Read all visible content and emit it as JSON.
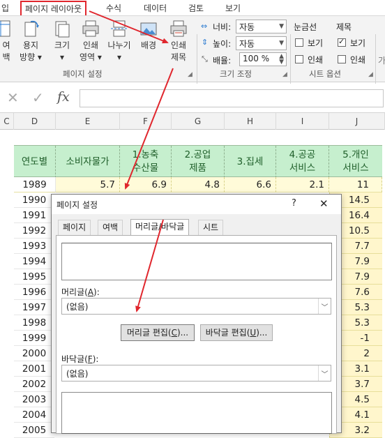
{
  "ribbon": {
    "tabs": [
      "입",
      "페이지 레이아웃",
      "수식",
      "데이터",
      "검토",
      "보기"
    ],
    "buttons": {
      "margins": "여백",
      "orientation": [
        "용지",
        "방향 ▾"
      ],
      "size": [
        "크기",
        "▾"
      ],
      "print_area": [
        "인쇄",
        "영역 ▾"
      ],
      "breaks": [
        "나누기",
        "▾"
      ],
      "background": "배경",
      "print_titles": [
        "인쇄",
        "제목"
      ]
    },
    "group_page_setup": "페이지 설정",
    "group_scale": "크기 조정",
    "group_sheet_options": "시트 옵션",
    "scale": {
      "width_label": "너비:",
      "width_value": "자동",
      "height_label": "높이:",
      "height_value": "자동",
      "scale_label": "배율:",
      "scale_value": "100 %"
    },
    "sheet_options": {
      "gridlines_title": "눈금선",
      "headings_title": "제목",
      "view": "보기",
      "print": "인쇄"
    },
    "edge_label": "가"
  },
  "formula_bar": {
    "cancel": "✕",
    "enter": "✓",
    "fx": "fx",
    "value": ""
  },
  "columns": [
    "C",
    "D",
    "E",
    "F",
    "G",
    "H",
    "I",
    "J"
  ],
  "table": {
    "headers": [
      "연도별",
      "소비자물가",
      "1.농축\n수산물",
      "2.공업\n제품",
      "3.집세",
      "4.공공\n서비스",
      "5.개인\n서비스"
    ],
    "row_1989": [
      "1989",
      "5.7",
      "6.9",
      "4.8",
      "6.6",
      "2.1",
      "11"
    ],
    "years": [
      "1990",
      "1991",
      "1992",
      "1993",
      "1994",
      "1995",
      "1996",
      "1997",
      "1998",
      "1999",
      "2000",
      "2001",
      "2002",
      "2003",
      "2004",
      "2005"
    ],
    "j_values": [
      "14.5",
      "16.4",
      "10.5",
      "7.7",
      "7.9",
      "7.9",
      "7.6",
      "5.3",
      "5.3",
      "-1",
      "2",
      "3.1",
      "3.7",
      "4.5",
      "4.1",
      "3.2"
    ]
  },
  "dialog": {
    "title": "페이지 설정",
    "help": "?",
    "close": "✕",
    "tabs": [
      "페이지",
      "여백",
      "머리글/바닥글",
      "시트"
    ],
    "active_tab": "머리글/바닥글",
    "header_label": "머리글(A):",
    "header_value": "(없음)",
    "edit_header_button": "머리글 편집(C)...",
    "edit_footer_button": "바닥글 편집(U)...",
    "footer_label": "바닥글(F):",
    "footer_value": "(없음)"
  },
  "colors": {
    "annotation_red": "#e0262d",
    "header_green": "#c6efce",
    "header_text": "#1f5f2a",
    "data_yellow": "#fffbd9"
  }
}
